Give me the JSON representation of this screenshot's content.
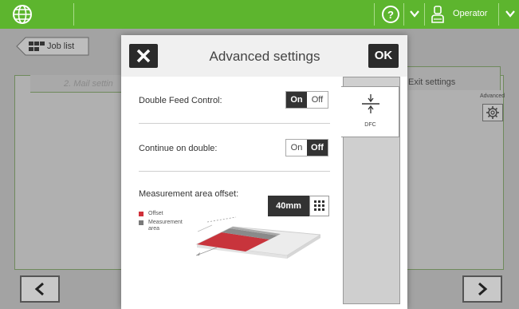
{
  "topbar": {
    "user_label": "Operator",
    "icons": [
      "globe-icon",
      "help-icon",
      "chevron-down-icon",
      "user-icon",
      "chevron-down-icon"
    ],
    "accent": "#5db52e"
  },
  "background": {
    "job_list_label": "Job list",
    "mail_tab_label": "2. Mail settin",
    "exit_tab_label": "Exit settings",
    "advanced_label": "Advanced"
  },
  "modal": {
    "title": "Advanced settings",
    "ok_label": "OK",
    "settings": {
      "double_feed": {
        "label": "Double Feed Control:",
        "on": "On",
        "off": "Off",
        "value": "On"
      },
      "continue_double": {
        "label": "Continue on double:",
        "on": "On",
        "off": "Off",
        "value": "Off"
      },
      "offset": {
        "label": "Measurement area offset:",
        "value": "40mm"
      }
    },
    "legend": [
      {
        "label": "Offset",
        "color": "#d0303a"
      },
      {
        "label": "Measurement\narea",
        "color": "#7a7a7a"
      }
    ],
    "tabs": [
      {
        "label": "DFC",
        "icon": "dfc-icon",
        "selected": true
      }
    ]
  }
}
